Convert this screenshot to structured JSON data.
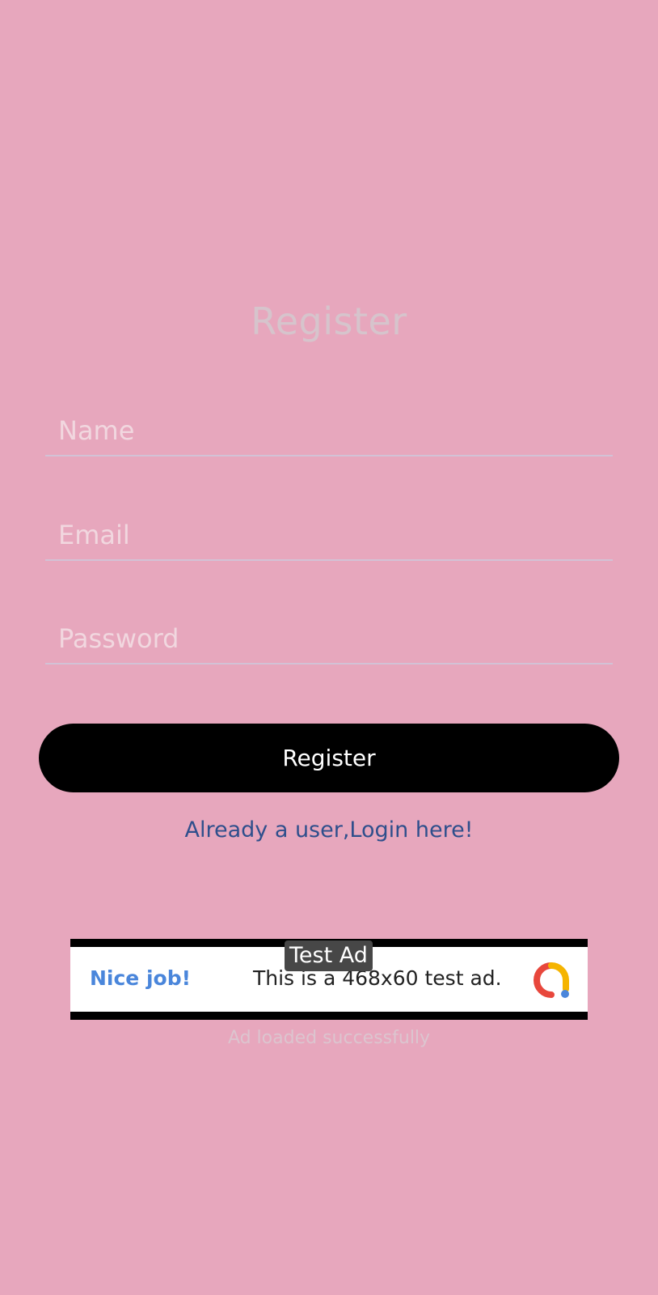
{
  "form": {
    "title": "Register",
    "name_placeholder": "Name",
    "email_placeholder": "Email",
    "password_placeholder": "Password",
    "register_label": "Register",
    "login_link": "Already a user,Login here!"
  },
  "ad": {
    "badge": "Test Ad",
    "headline": "Nice job!",
    "body": "This is a 468x60 test ad.",
    "logo_icon": "ad-manager-logo-icon",
    "status": "Ad loaded successfully"
  },
  "colors": {
    "background": "#e7a7bd",
    "button": "#000000",
    "link": "#2f4f8c",
    "ad_headline": "#4a86db"
  }
}
